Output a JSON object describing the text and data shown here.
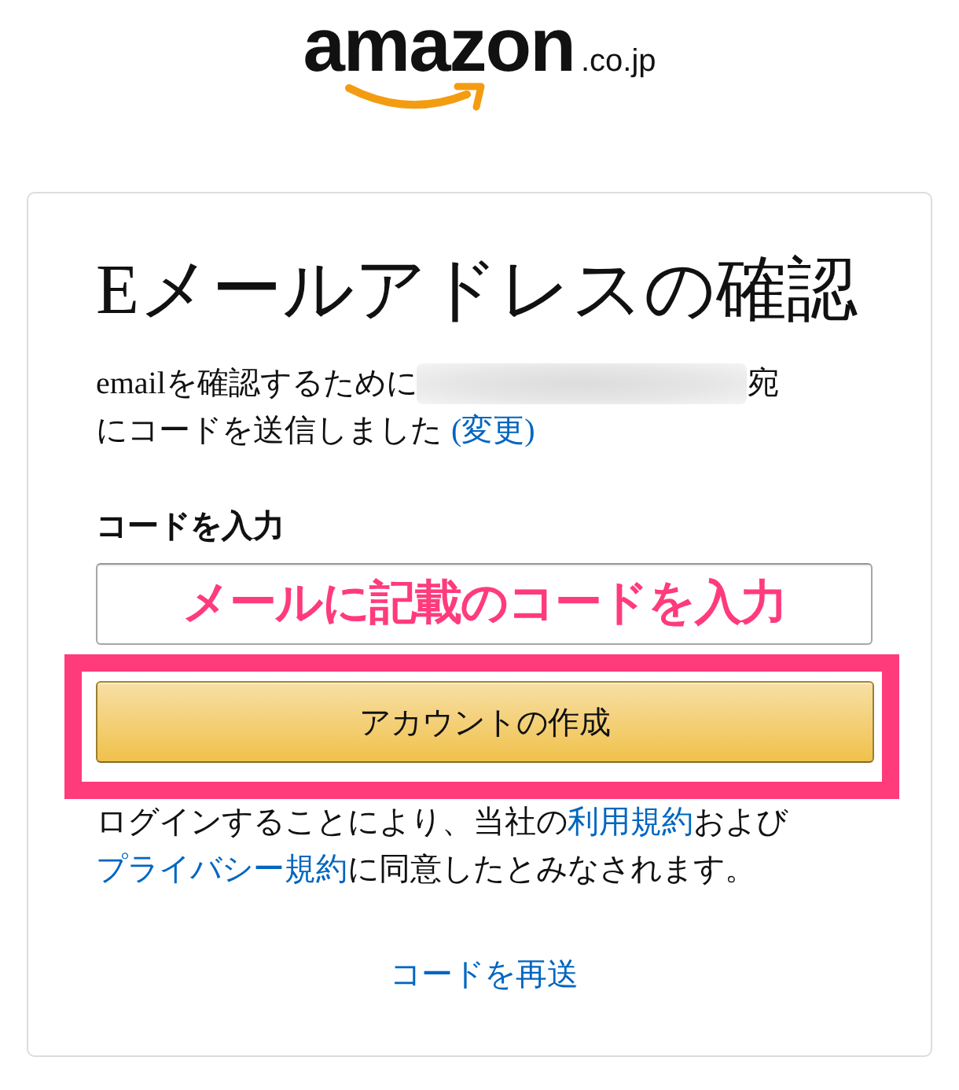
{
  "logo": {
    "wordmark": "amazon",
    "domain": ".co.jp"
  },
  "title": "Eメールアドレスの確認",
  "notice": [
    {
      "kind": "text",
      "text": "emailを確認するために"
    },
    {
      "kind": "redacted"
    },
    {
      "kind": "text",
      "text": "宛"
    },
    {
      "kind": "text",
      "text": "にコードを送信しました"
    },
    {
      "kind": "link",
      "text": "(変更)"
    }
  ],
  "code_field": {
    "label": "コードを入力",
    "annotation": "メールに記載のコードを入力"
  },
  "create_button": {
    "label": "アカウントの作成",
    "highlighted": true
  },
  "consent": [
    {
      "kind": "text",
      "text": "ログインすることにより、当社の"
    },
    {
      "kind": "link",
      "text": "利用規約"
    },
    {
      "kind": "text",
      "text": "および"
    },
    {
      "kind": "link",
      "text": "プライバシー規約"
    },
    {
      "kind": "text",
      "text": "に同意したとみなされます。"
    }
  ],
  "resend_link": "コードを再送"
}
